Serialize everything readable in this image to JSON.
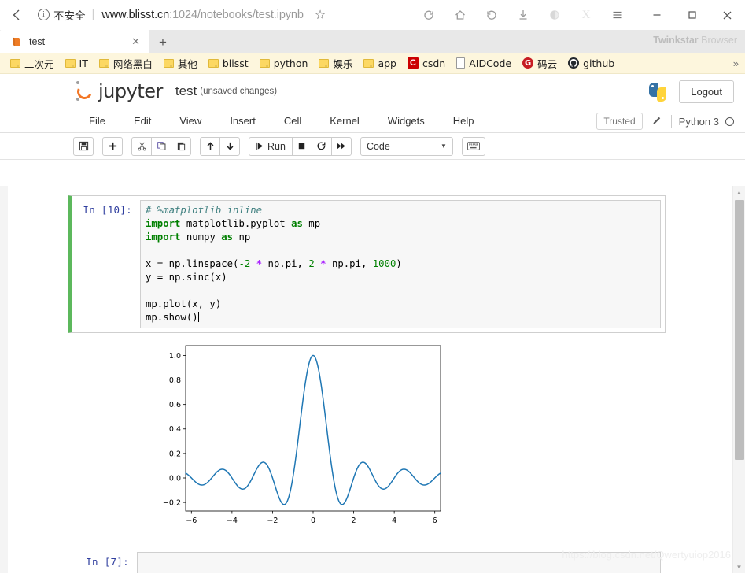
{
  "browser": {
    "back_icon": "back-arrow-icon",
    "security": {
      "info_icon": "info-circle-icon",
      "label": "不安全",
      "separator": "|"
    },
    "url": {
      "host": "www.blisst.cn",
      "path": ":1024/notebooks/test.ipynb",
      "full": "www.blisst.cn:1024/notebooks/test.ipynb"
    },
    "bookmark_star": "☆",
    "toolbar_icons": [
      {
        "name": "sync-icon",
        "glyph": "⟳"
      },
      {
        "name": "home-icon",
        "glyph": "⌂"
      },
      {
        "name": "history-icon",
        "glyph": "↺"
      },
      {
        "name": "download-icon",
        "glyph": "⤓"
      },
      {
        "name": "theme-icon",
        "glyph": "◐"
      },
      {
        "name": "extension-icon",
        "glyph": "X"
      },
      {
        "name": "menu-icon",
        "glyph": "☰"
      }
    ],
    "window_controls": [
      {
        "name": "minimize-button",
        "glyph": "–"
      },
      {
        "name": "maximize-button",
        "glyph": "▢"
      },
      {
        "name": "close-button",
        "glyph": "✕"
      }
    ],
    "tab": {
      "title": "test",
      "favicon": "book-icon",
      "close_glyph": "✕",
      "new_tab_glyph": "+"
    },
    "brand": {
      "bold": "Twinkstar",
      "light": " Browser"
    },
    "bookmarks": [
      {
        "label": "二次元",
        "icon": "folder-icon"
      },
      {
        "label": "IT",
        "icon": "folder-icon"
      },
      {
        "label": "网络黑白",
        "icon": "folder-icon"
      },
      {
        "label": "其他",
        "icon": "folder-icon"
      },
      {
        "label": "blisst",
        "icon": "folder-icon"
      },
      {
        "label": "python",
        "icon": "folder-icon"
      },
      {
        "label": "娱乐",
        "icon": "folder-icon"
      },
      {
        "label": "app",
        "icon": "folder-icon"
      },
      {
        "label": "csdn",
        "icon": "csdn-icon"
      },
      {
        "label": "AIDCode",
        "icon": "document-icon"
      },
      {
        "label": "码云",
        "icon": "gitee-icon"
      },
      {
        "label": "github",
        "icon": "github-icon"
      }
    ],
    "bookmarks_overflow": "»"
  },
  "jupyter": {
    "logo_text": "jupyter",
    "notebook_name": "test",
    "notebook_status": "(unsaved changes)",
    "logout_label": "Logout",
    "python_logo": "python-icon",
    "menu": [
      "File",
      "Edit",
      "View",
      "Insert",
      "Cell",
      "Kernel",
      "Widgets",
      "Help"
    ],
    "trusted_label": "Trusted",
    "edit_mode_icon": "pencil-icon",
    "kernel_name": "Python 3",
    "kernel_status_icon": "kernel-idle-circle",
    "toolbar": {
      "save_icon": "save-floppy-icon",
      "insert_icon": "add-cell-plus-icon",
      "cut_icon": "scissors-icon",
      "copy_icon": "copy-icon",
      "paste_icon": "paste-icon",
      "move_up_icon": "arrow-up-icon",
      "move_down_icon": "arrow-down-icon",
      "run_label": "Run",
      "run_icon": "run-play-icon",
      "stop_icon": "stop-square-icon",
      "restart_icon": "restart-icon",
      "restart_run_all_icon": "fast-forward-icon",
      "cell_type": "Code",
      "cell_type_caret": "▼",
      "command_palette_icon": "keyboard-icon"
    }
  },
  "cells": [
    {
      "prompt": "In  [10]:",
      "type": "code",
      "selected": true,
      "source_lines": [
        "# %matplotlib inline",
        "import matplotlib.pyplot as mp",
        "import numpy as np",
        "",
        "x = np.linspace(-2 * np.pi, 2 * np.pi, 1000)",
        "y = np.sinc(x)",
        "",
        "mp.plot(x, y)",
        "mp.show()"
      ]
    },
    {
      "prompt": "In  [7]:",
      "type": "code",
      "selected": false,
      "source_lines": [
        ""
      ]
    }
  ],
  "watermark": "https://blog.csdn.net/Qwertyuiop2016",
  "colors": {
    "selected_cell_border": "#5cb85c",
    "line_color": "#1f77b4",
    "jupyter_orange": "#f37726",
    "bookmark_bar_bg": "#fdf6dd"
  },
  "chart_data": {
    "type": "line",
    "title": "",
    "xlabel": "",
    "ylabel": "",
    "xlim": [
      -6.283185307,
      6.283185307
    ],
    "ylim": [
      -0.27,
      1.08
    ],
    "xticks": [
      -6,
      -4,
      -2,
      0,
      2,
      4,
      6
    ],
    "yticks": [
      -0.2,
      0.0,
      0.2,
      0.4,
      0.6,
      0.8,
      1.0
    ],
    "grid": false,
    "legend": null,
    "series": [
      {
        "name": "np.sinc(x)",
        "color": "#1f77b4",
        "linewidth": 1.5,
        "expression": "sin(pi*x)/(pi*x)",
        "n_points": 1000,
        "x_start": -6.283185307,
        "x_end": 6.283185307,
        "key_points": [
          {
            "x": -6.283185307,
            "y": 0.0435
          },
          {
            "x": -5.5,
            "y": -0.0578
          },
          {
            "x": -4.5,
            "y": 0.0707
          },
          {
            "x": -3.47,
            "y": -0.0898
          },
          {
            "x": -2.46,
            "y": 0.1284
          },
          {
            "x": -1.43,
            "y": -0.2172
          },
          {
            "x": -1.0,
            "y": 0.0
          },
          {
            "x": 0.0,
            "y": 1.0
          },
          {
            "x": 1.0,
            "y": 0.0
          },
          {
            "x": 1.43,
            "y": -0.2172
          },
          {
            "x": 2.46,
            "y": 0.1284
          },
          {
            "x": 3.47,
            "y": -0.0898
          },
          {
            "x": 4.5,
            "y": 0.0707
          },
          {
            "x": 5.5,
            "y": -0.0578
          },
          {
            "x": 6.283185307,
            "y": 0.0435
          }
        ]
      }
    ]
  }
}
